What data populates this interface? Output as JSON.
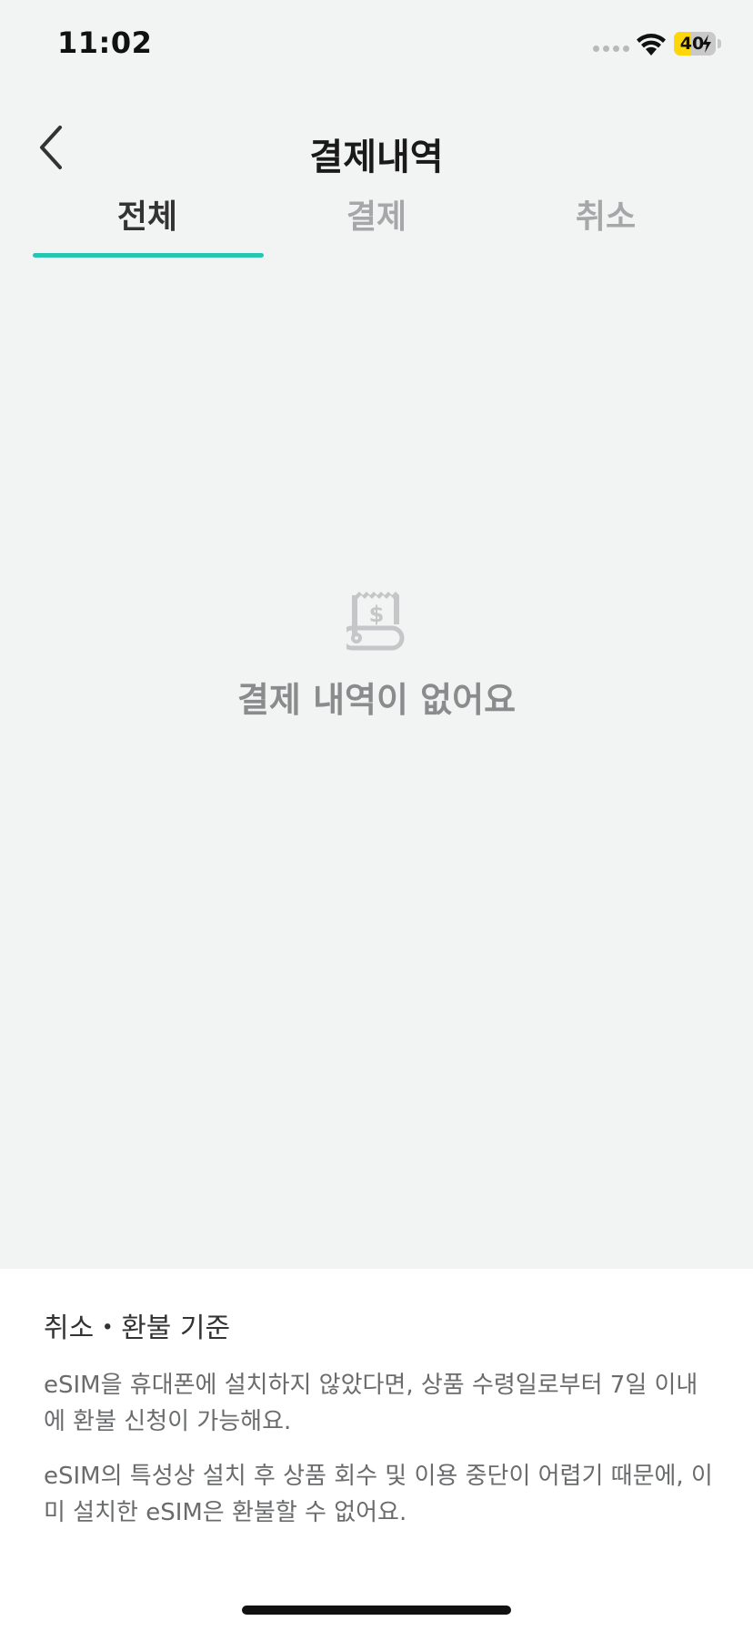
{
  "status_bar": {
    "time": "11:02",
    "battery_level": 40,
    "battery_text": "40",
    "battery_color": "#ffd60a",
    "icons": [
      "signal-icon",
      "wifi-icon",
      "battery-icon",
      "charging-bolt-icon"
    ]
  },
  "header": {
    "title": "결제내역",
    "back_icon": "chevron-left-icon"
  },
  "tabs": [
    {
      "label": "전체",
      "active": true
    },
    {
      "label": "결제",
      "active": false
    },
    {
      "label": "취소",
      "active": false
    }
  ],
  "accent_color": "#27c6b2",
  "empty_state": {
    "icon": "receipt-icon",
    "message": "결제 내역이 없어요"
  },
  "policy": {
    "title": "취소・환불 기준",
    "paragraphs": [
      "eSIM을 휴대폰에 설치하지 않았다면, 상품 수령일로부터 7일 이내에 환불 신청이 가능해요.",
      "eSIM의 특성상 설치 후 상품 회수 및 이용 중단이 어렵기 때문에, 이미 설치한 eSIM은 환불할 수 없어요."
    ]
  }
}
